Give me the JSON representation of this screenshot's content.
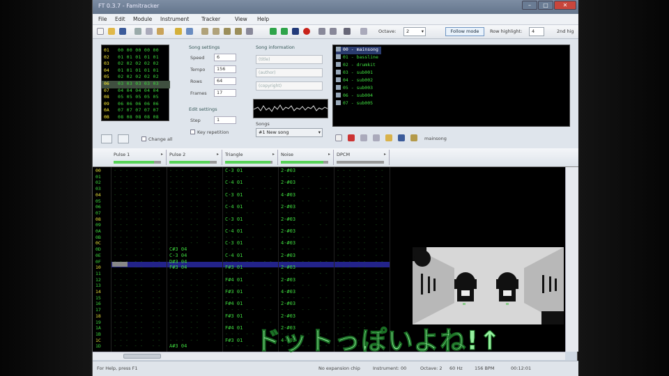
{
  "window": {
    "title": "FT 0.3.7 - Famitracker"
  },
  "menu": [
    "File",
    "Edit",
    "Module",
    "Instrument",
    "Tracker",
    "View",
    "Help"
  ],
  "toolbar": {
    "octave_label": "Octave:",
    "octave_value": "2",
    "follow_label": "Follow mode",
    "row_highlight_label": "Row highlight:",
    "row_highlight_value": "4",
    "second_highlight_label": "2nd hig"
  },
  "frames": {
    "rows": [
      {
        "n": "01",
        "v": "00 00 00 00 00"
      },
      {
        "n": "02",
        "v": "01 01 01 01 01"
      },
      {
        "n": "03",
        "v": "02 02 02 02 02"
      },
      {
        "n": "04",
        "v": "01 01 01 01 01"
      },
      {
        "n": "05",
        "v": "02 02 02 02 02"
      },
      {
        "n": "06",
        "v": "03 03 03 03 03"
      },
      {
        "n": "07",
        "v": "04 04 04 04 04"
      },
      {
        "n": "08",
        "v": "05 05 05 05 05"
      },
      {
        "n": "09",
        "v": "06 06 06 06 06"
      },
      {
        "n": "0A",
        "v": "07 07 07 07 07"
      },
      {
        "n": "0B",
        "v": "08 08 08 08 08"
      }
    ],
    "change_all": "Change all"
  },
  "song_settings": {
    "title": "Song settings",
    "speed_label": "Speed",
    "speed_value": "6",
    "tempo_label": "Tempo",
    "tempo_value": "156",
    "rows_label": "Rows",
    "rows_value": "64",
    "frames_label": "Frames",
    "frames_value": "17"
  },
  "edit_settings": {
    "title": "Edit settings",
    "step_label": "Step",
    "step_value": "1",
    "key_rep_label": "Key repetition"
  },
  "song_info": {
    "title": "Song information",
    "name_placeholder": "(title)",
    "author_placeholder": "(author)",
    "copyright_placeholder": "(copyright)"
  },
  "songs": {
    "label": "Songs",
    "value": "#1 New song"
  },
  "instruments": [
    {
      "label": "00 - mainsong",
      "sel": true
    },
    {
      "label": "01 - bassline"
    },
    {
      "label": "02 - drumkit"
    },
    {
      "label": "03 - sub001"
    },
    {
      "label": "04 - sub002"
    },
    {
      "label": "05 - sub003"
    },
    {
      "label": "06 - sub004"
    },
    {
      "label": "07 - sub005"
    }
  ],
  "instrument_name": "mainsong",
  "channels": [
    {
      "name": "Pulse 1",
      "level": 0.85
    },
    {
      "name": "Pulse 2",
      "level": 0.85
    },
    {
      "name": "Triangle",
      "level": 0.95
    },
    {
      "name": "Noise",
      "level": 0.9
    },
    {
      "name": "DPCM",
      "level": 0.0
    }
  ],
  "pattern": {
    "rows": [
      "00",
      "01",
      "02",
      "03",
      "04",
      "05",
      "06",
      "07",
      "08",
      "09",
      "0A",
      "0B",
      "0C",
      "0D",
      "0E",
      "0F",
      "10",
      "11",
      "12",
      "13",
      "14",
      "15",
      "16",
      "17",
      "18",
      "19",
      "1A",
      "1B",
      "1C",
      "1D"
    ],
    "pulse2": {
      "13": "C#3 04",
      "14": "C-3 04",
      "15": "D#3 04",
      "16": "F#3 04",
      "29": "A#3 04"
    },
    "triangle": {
      "0": "C-3 01",
      "2": "C-4 01",
      "4": "C-3 01",
      "6": "C-4 01",
      "8": "C-3 01",
      "10": "C-4 01",
      "12": "C-3 01",
      "14": "C-4 01",
      "16": "F#3 01",
      "18": "F#4 01",
      "20": "F#3 01",
      "22": "F#4 01",
      "24": "F#3 01",
      "26": "F#4 01",
      "28": "F#3 01"
    },
    "noise": {
      "0": "2-#03",
      "2": "2-#03",
      "4": "4-#03",
      "6": "2-#03",
      "8": "2-#03",
      "10": "2-#03",
      "12": "4-#03",
      "14": "2-#03",
      "16": "2-#03",
      "18": "2-#03",
      "20": "4-#03",
      "22": "2-#03",
      "24": "2-#03",
      "26": "2-#03",
      "28": "4-#03"
    }
  },
  "status": {
    "help": "For Help, press F1",
    "chip": "No expansion chip",
    "instrument": "Instrument: 00",
    "octave": "Octave: 2",
    "rate": "60 Hz",
    "bpm": "156 BPM",
    "time": "00:12:01"
  },
  "caption": "ドットっぽいよね!↑"
}
